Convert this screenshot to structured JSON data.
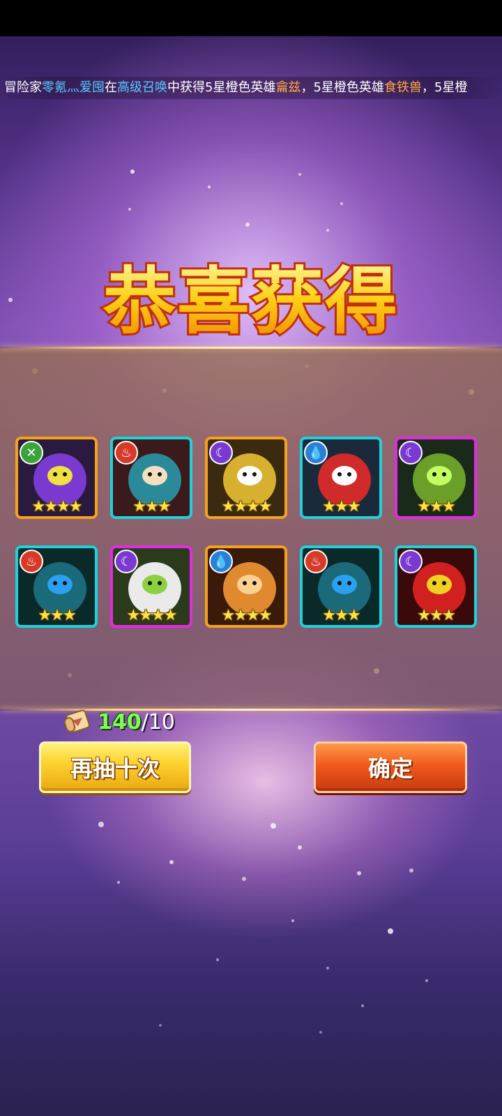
{
  "marquee": {
    "p1": "冒险家",
    "player": "零氪灬爱囤",
    "p2": "在",
    "pool": "高级召唤",
    "p3": "中获得5星橙色英雄",
    "hero1": "龠兹",
    "p4": "，5星橙色英雄",
    "hero2": "食铁兽",
    "p5": "，5星橙"
  },
  "title": "恭喜获得",
  "heroes": [
    {
      "element": "wind-icon",
      "frame": "orange",
      "stars": "★★★★"
    },
    {
      "element": "fire-icon",
      "frame": "cyan",
      "stars": "★★★"
    },
    {
      "element": "moon-icon",
      "frame": "orange",
      "stars": "★★★★"
    },
    {
      "element": "water-icon",
      "frame": "cyan",
      "stars": "★★★"
    },
    {
      "element": "moon-icon",
      "frame": "magenta",
      "stars": "★★★"
    },
    {
      "element": "fire-icon",
      "frame": "cyan",
      "stars": "★★★"
    },
    {
      "element": "moon-icon",
      "frame": "magenta",
      "stars": "★★★★"
    },
    {
      "element": "water-icon",
      "frame": "orange",
      "stars": "★★★★"
    },
    {
      "element": "fire-icon",
      "frame": "cyan",
      "stars": "★★★"
    },
    {
      "element": "moon-icon",
      "frame": "cyan",
      "stars": "★★★"
    }
  ],
  "counter": {
    "current": "140",
    "sep": "/",
    "cost": "10"
  },
  "buttons": {
    "again": "再抽十次",
    "confirm": "确定"
  },
  "colors": {
    "orange_frame": "#f4a21c",
    "cyan_frame": "#1fd1da",
    "magenta_frame": "#e02ce0",
    "count_green": "#7dff54"
  }
}
